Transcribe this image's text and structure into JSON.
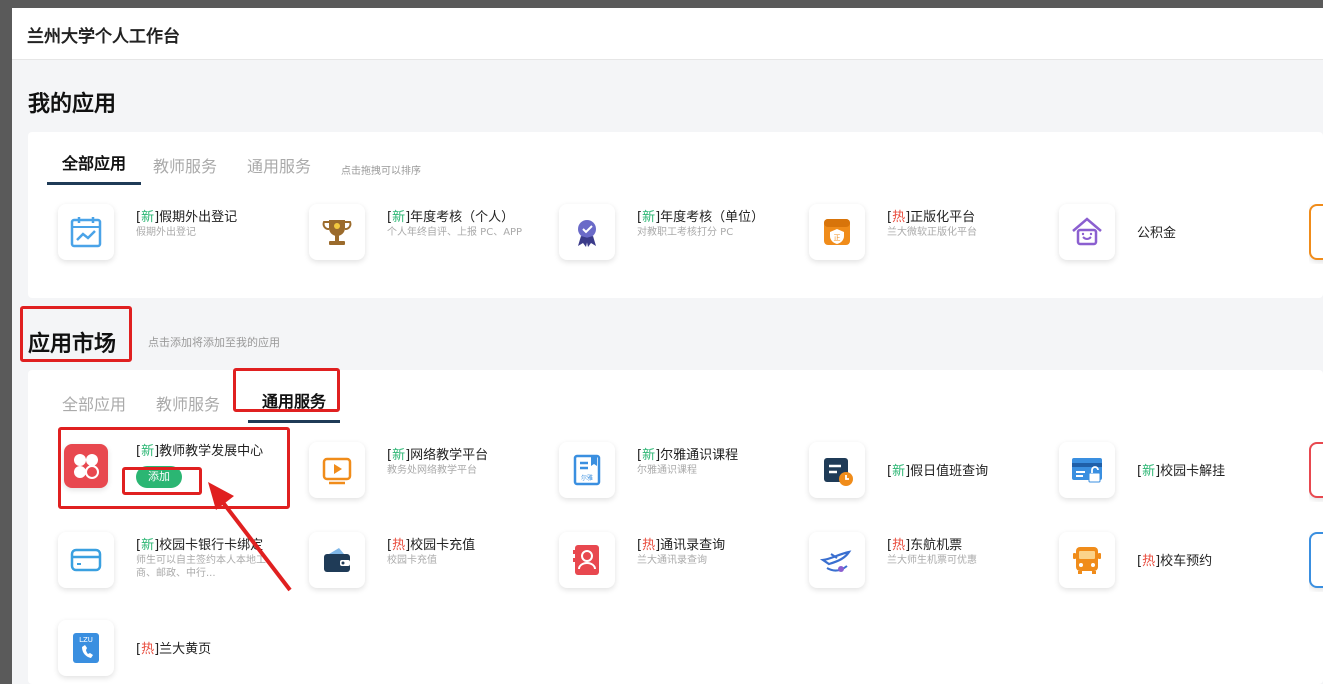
{
  "header": {
    "title": "兰州大学个人工作台"
  },
  "my_apps": {
    "title": "我的应用",
    "tabs": [
      "全部应用",
      "教师服务",
      "通用服务"
    ],
    "hint": "点击拖拽可以排序",
    "apps": [
      {
        "tag": "新",
        "tag_type": "new",
        "name": "假期外出登记",
        "desc": "假期外出登记",
        "icon": "calendar-chart-icon",
        "color": "#4aa3e8"
      },
      {
        "tag": "新",
        "tag_type": "new",
        "name": "年度考核（个人）",
        "desc": "个人年终自评、上报 PC、APP",
        "icon": "trophy-icon",
        "color": "#9b6b2c"
      },
      {
        "tag": "新",
        "tag_type": "new",
        "name": "年度考核（单位）",
        "desc": "对教职工考核打分 PC",
        "icon": "medal-icon",
        "color": "#6a6ac8"
      },
      {
        "tag": "热",
        "tag_type": "hot",
        "name": "正版化平台",
        "desc": "兰大微软正版化平台",
        "icon": "shield-box-icon",
        "color": "#f08c1a"
      },
      {
        "tag": "",
        "tag_type": "",
        "name": "公积金",
        "desc": "",
        "icon": "house-icon",
        "color": "#8b5fd0"
      }
    ]
  },
  "market": {
    "title": "应用市场",
    "hint": "点击添加将添加至我的应用",
    "tabs": [
      "全部应用",
      "教师服务",
      "通用服务"
    ],
    "add_label": "添加",
    "apps": [
      {
        "tag": "新",
        "tag_type": "new",
        "name": "教师教学发展中心",
        "desc": "",
        "icon": "flower-icon",
        "color": "#e8484f"
      },
      {
        "tag": "新",
        "tag_type": "new",
        "name": "网络教学平台",
        "desc": "教务处网络教学平台",
        "icon": "play-icon",
        "color": "#f08c1a"
      },
      {
        "tag": "新",
        "tag_type": "new",
        "name": "尔雅通识课程",
        "desc": "尔雅通识课程",
        "icon": "book-icon",
        "color": "#3a8fe0",
        "icon_text": "尔雅"
      },
      {
        "tag": "新",
        "tag_type": "new",
        "name": "假日值班查询",
        "desc": "",
        "icon": "duty-calendar-icon",
        "color": "#1f3b57"
      },
      {
        "tag": "新",
        "tag_type": "new",
        "name": "校园卡解挂",
        "desc": "",
        "icon": "card-unlock-icon",
        "color": "#3a8fe0"
      },
      {
        "tag": "新",
        "tag_type": "new",
        "name": "校园卡银行卡绑定",
        "desc": "师生可以自主签约本人本地工商、邮政、中行...",
        "icon": "bank-card-icon",
        "color": "#3aa0e0"
      },
      {
        "tag": "热",
        "tag_type": "hot",
        "name": "校园卡充值",
        "desc": "校园卡充值",
        "icon": "wallet-icon",
        "color": "#1f3b57"
      },
      {
        "tag": "热",
        "tag_type": "hot",
        "name": "通讯录查询",
        "desc": "兰大通讯录查询",
        "icon": "contacts-icon",
        "color": "#e8484f"
      },
      {
        "tag": "热",
        "tag_type": "hot",
        "name": "东航机票",
        "desc": "兰大师生机票可优惠",
        "icon": "plane-icon",
        "color": "#3a6fd0"
      },
      {
        "tag": "热",
        "tag_type": "hot",
        "name": "校车预约",
        "desc": "",
        "icon": "bus-icon",
        "color": "#f08c1a"
      },
      {
        "tag": "热",
        "tag_type": "hot",
        "name": "兰大黄页",
        "desc": "",
        "icon": "phone-book-icon",
        "color": "#3a8fe0",
        "icon_text": "LZU"
      }
    ]
  }
}
